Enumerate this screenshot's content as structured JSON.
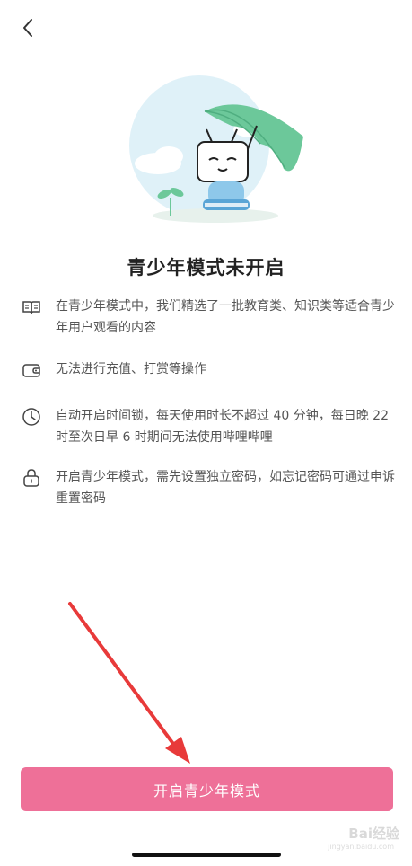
{
  "nav": {
    "back_icon": "chevron-left-icon"
  },
  "page": {
    "title": "青少年模式未开启"
  },
  "features": [
    {
      "icon": "book-icon",
      "text": "在青少年模式中，我们精选了一批教育类、知识类等适合青少年用户观看的内容"
    },
    {
      "icon": "wallet-icon",
      "text": "无法进行充值、打赏等操作"
    },
    {
      "icon": "clock-icon",
      "text": "自动开启时间锁，每天使用时长不超过 40 分钟，每日晚 22 时至次日早 6 时期间无法使用哔哩哔哩"
    },
    {
      "icon": "lock-icon",
      "text": "开启青少年模式，需先设置独立密码，如忘记密码可通过申诉重置密码"
    }
  ],
  "action": {
    "primary_label": "开启青少年模式"
  },
  "watermark": {
    "text": "Bai经验",
    "sub": "jingyan.baidu.com"
  },
  "colors": {
    "primary": "#ee7098",
    "umbrella": "#6cc89a",
    "sky": "#dff1f8",
    "arrow": "#e83a3a"
  }
}
